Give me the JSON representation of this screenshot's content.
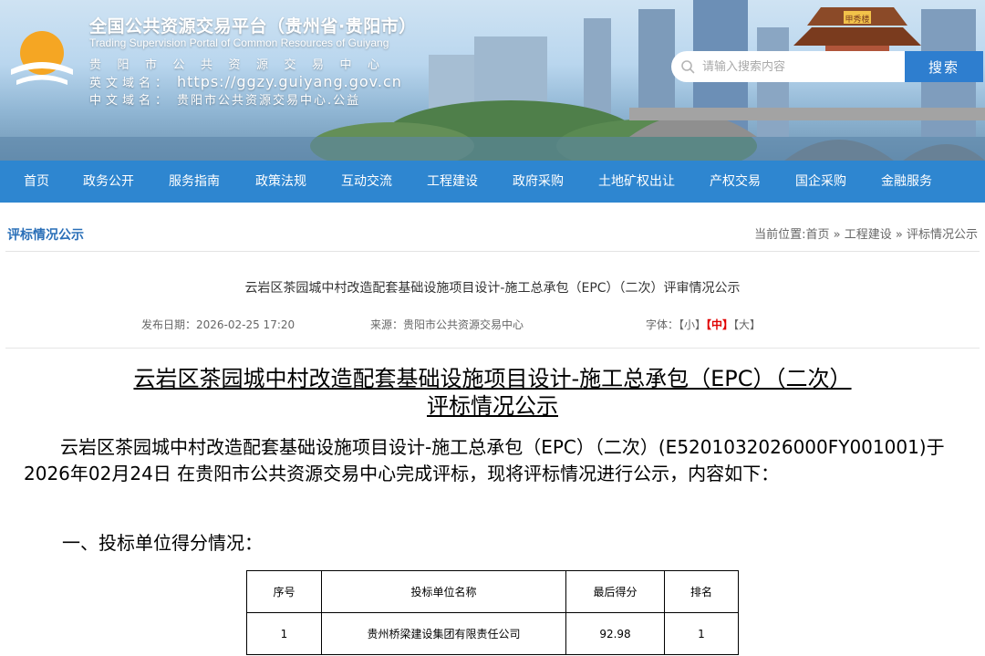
{
  "header": {
    "site_title": "全国公共资源交易平台（贵州省·贵阳市）",
    "site_subtitle": "Trading Supervision Portal of Common Resources of Guiyang",
    "center_name": "贵阳市公共资源交易中心",
    "en_domain_label": "英文域名：",
    "en_domain": "https://ggzy.guiyang.gov.cn",
    "cn_domain_label": "中文域名：",
    "cn_domain": "贵阳市公共资源交易中心.公益",
    "search_placeholder": "请输入搜索内容",
    "search_button": "搜索",
    "pavilion_sign": "甲秀楼"
  },
  "nav": [
    "首页",
    "政务公开",
    "服务指南",
    "政策法规",
    "互动交流",
    "工程建设",
    "政府采购",
    "土地矿权出让",
    "产权交易",
    "国企采购",
    "金融服务"
  ],
  "breadcrumb": {
    "section_title": "评标情况公示",
    "path": "当前位置:首页 » 工程建设 » 评标情况公示"
  },
  "article": {
    "title": "云岩区茶园城中村改造配套基础设施项目设计-施工总承包（EPC）（二次）评审情况公示",
    "date": "发布日期：2026-02-25 17:20",
    "source": "来源：贵阳市公共资源交易中心",
    "font_label": "字体：",
    "font_small": "【小】",
    "font_medium": "【中】",
    "font_large": "【大】"
  },
  "body": {
    "heading_line1": "云岩区茶园城中村改造配套基础设施项目设计-施工总承包（EPC）（二次）",
    "heading_line2": "评标情况公示",
    "paragraph": "云岩区茶园城中村改造配套基础设施项目设计-施工总承包（EPC）（二次）(E5201032026000FY001001)于2026年02月24日 在贵阳市公共资源交易中心完成评标，现将评标情况进行公示，内容如下：",
    "section1": "一、投标单位得分情况："
  },
  "score_table": {
    "headers": [
      "序号",
      "投标单位名称",
      "最后得分",
      "排名"
    ],
    "rows": [
      [
        "1",
        "贵州桥梁建设集团有限责任公司",
        "92.98",
        "1"
      ]
    ]
  },
  "colors": {
    "nav_bg": "#2e86d0",
    "search_button_bg": "#2e7ecf",
    "section_title": "#2a6fb8",
    "active_font": "#e00000"
  }
}
